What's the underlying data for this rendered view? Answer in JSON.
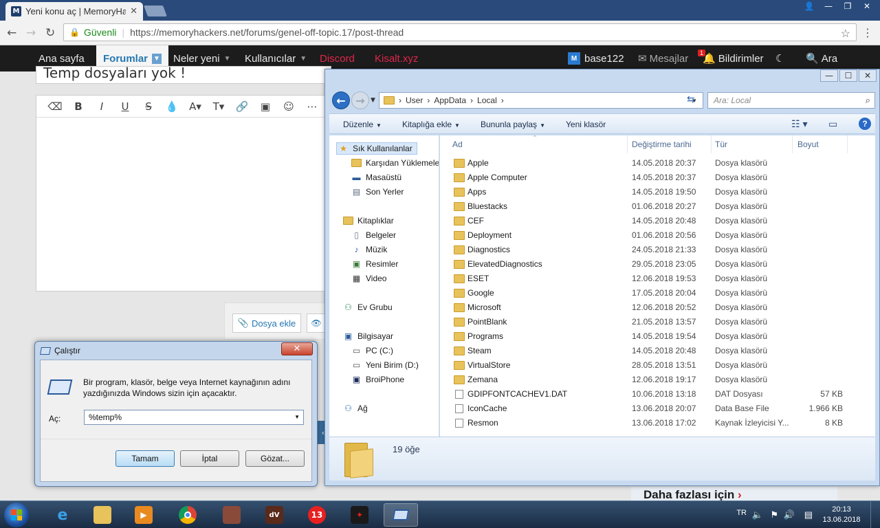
{
  "browser": {
    "tab_title": "Yeni konu aç | MemoryHa",
    "tab_close": "✕",
    "omnibox_secure": "Güvenli",
    "omnibox_url": "https://memoryhackers.net/forums/genel-off-topic.17/post-thread"
  },
  "site_nav": {
    "home": "Ana sayfa",
    "forums": "Forumlar",
    "whats_new": "Neler yeni",
    "members": "Kullanıcılar",
    "discord": "Discord",
    "kisalt": "Kisalt.xyz",
    "user": "base122",
    "messages": "Mesajlar",
    "alerts": "Bildirimler",
    "alerts_count": "1",
    "search": "Ara"
  },
  "page": {
    "thread_title_partial": "Temp dosyaları yok !",
    "attach_label": "Dosya ekle",
    "ad_text": "Daha fazlası için"
  },
  "explorer": {
    "breadcrumb": [
      "User",
      "AppData",
      "Local"
    ],
    "search_placeholder": "Ara: Local",
    "toolbar": {
      "organize": "Düzenle",
      "add_to_library": "Kitaplığa ekle",
      "share_with": "Bununla paylaş",
      "new_folder": "Yeni klasör"
    },
    "nav_pane": {
      "favorites": "Sık Kullanılanlar",
      "downloads": "Karşıdan Yüklemeler",
      "desktop": "Masaüstü",
      "recent": "Son Yerler",
      "libraries": "Kitaplıklar",
      "documents": "Belgeler",
      "music": "Müzik",
      "pictures": "Resimler",
      "video": "Video",
      "homegroup": "Ev Grubu",
      "computer": "Bilgisayar",
      "drive_c": "PC (C:)",
      "drive_d": "Yeni Birim (D:)",
      "iphone": "BroiPhone",
      "network": "Ağ"
    },
    "columns": {
      "name": "Ad",
      "date": "Değiştirme tarihi",
      "type": "Tür",
      "size": "Boyut"
    },
    "rows": [
      {
        "icon": "folder",
        "name": "Apple",
        "date": "14.05.2018 20:37",
        "type": "Dosya klasörü",
        "size": ""
      },
      {
        "icon": "folder",
        "name": "Apple Computer",
        "date": "14.05.2018 20:37",
        "type": "Dosya klasörü",
        "size": ""
      },
      {
        "icon": "folder",
        "name": "Apps",
        "date": "14.05.2018 19:50",
        "type": "Dosya klasörü",
        "size": ""
      },
      {
        "icon": "folder",
        "name": "Bluestacks",
        "date": "01.06.2018 20:27",
        "type": "Dosya klasörü",
        "size": ""
      },
      {
        "icon": "folder",
        "name": "CEF",
        "date": "14.05.2018 20:48",
        "type": "Dosya klasörü",
        "size": ""
      },
      {
        "icon": "folder",
        "name": "Deployment",
        "date": "01.06.2018 20:56",
        "type": "Dosya klasörü",
        "size": ""
      },
      {
        "icon": "folder",
        "name": "Diagnostics",
        "date": "24.05.2018 21:33",
        "type": "Dosya klasörü",
        "size": ""
      },
      {
        "icon": "folder",
        "name": "ElevatedDiagnostics",
        "date": "29.05.2018 23:05",
        "type": "Dosya klasörü",
        "size": ""
      },
      {
        "icon": "folder",
        "name": "ESET",
        "date": "12.06.2018 19:53",
        "type": "Dosya klasörü",
        "size": ""
      },
      {
        "icon": "folder",
        "name": "Google",
        "date": "17.05.2018 20:04",
        "type": "Dosya klasörü",
        "size": ""
      },
      {
        "icon": "folder",
        "name": "Microsoft",
        "date": "12.06.2018 20:52",
        "type": "Dosya klasörü",
        "size": ""
      },
      {
        "icon": "folder",
        "name": "PointBlank",
        "date": "21.05.2018 13:57",
        "type": "Dosya klasörü",
        "size": ""
      },
      {
        "icon": "folder",
        "name": "Programs",
        "date": "14.05.2018 19:54",
        "type": "Dosya klasörü",
        "size": ""
      },
      {
        "icon": "folder",
        "name": "Steam",
        "date": "14.05.2018 20:48",
        "type": "Dosya klasörü",
        "size": ""
      },
      {
        "icon": "folder",
        "name": "VirtualStore",
        "date": "28.05.2018 13:51",
        "type": "Dosya klasörü",
        "size": ""
      },
      {
        "icon": "folder",
        "name": "Zemana",
        "date": "12.06.2018 19:17",
        "type": "Dosya klasörü",
        "size": ""
      },
      {
        "icon": "file",
        "name": "GDIPFONTCACHEV1.DAT",
        "date": "10.06.2018 13:18",
        "type": "DAT Dosyası",
        "size": "57 KB"
      },
      {
        "icon": "file",
        "name": "IconCache",
        "date": "13.06.2018 20:07",
        "type": "Data Base File",
        "size": "1.966 KB"
      },
      {
        "icon": "res",
        "name": "Resmon",
        "date": "13.06.2018 17:02",
        "type": "Kaynak İzleyicisi Y...",
        "size": "8 KB"
      }
    ],
    "status_count": "19 öğe"
  },
  "run_dialog": {
    "title": "Çalıştır",
    "close": "✕",
    "description": "Bir program, klasör, belge veya Internet kaynağının adını yazdığınızda Windows sizin için açacaktır.",
    "open_label": "Aç:",
    "input_value": "%temp%",
    "ok": "Tamam",
    "cancel": "İptal",
    "browse": "Gözat..."
  },
  "taskbar": {
    "lang": "TR",
    "time": "20:13",
    "date": "13.06.2018",
    "app_13": "13"
  }
}
